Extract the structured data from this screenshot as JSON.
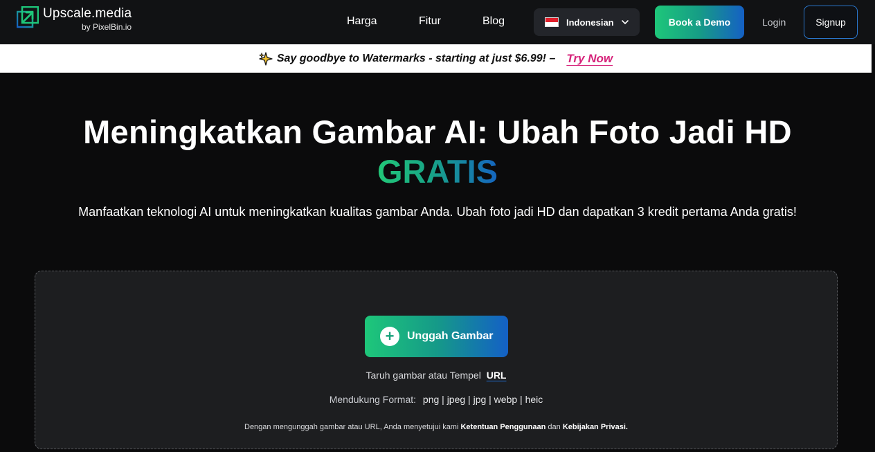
{
  "nav": {
    "brand": "Upscale.media",
    "brand_sub": "by PixelBin.io",
    "links": [
      "Harga",
      "Fitur",
      "Blog"
    ],
    "language": "Indonesian",
    "demo_label": "Book a Demo",
    "login_label": "Login",
    "signup_label": "Signup"
  },
  "banner": {
    "text": "Say goodbye to Watermarks - starting at just $6.99! –",
    "link": "Try Now"
  },
  "hero": {
    "title": "Meningkatkan Gambar AI: Ubah Foto Jadi HD",
    "accent": "GRATIS",
    "subtitle": "Manfaatkan teknologi AI untuk meningkatkan kualitas gambar Anda. Ubah foto jadi HD dan dapatkan 3 kredit pertama Anda gratis!"
  },
  "upload": {
    "button_label": "Unggah Gambar",
    "drop_text": "Taruh gambar atau Tempel",
    "url_label": "URL",
    "formats_label": "Mendukung Format:",
    "formats": "png | jpeg | jpg | webp | heic",
    "terms_prefix": "Dengan mengunggah gambar atau URL, Anda menyetujui kami",
    "terms_link": "Ketentuan Penggunaan",
    "terms_and": "dan",
    "privacy_link": "Kebijakan Privasi."
  },
  "colors": {
    "accent_green": "#1ec77a",
    "accent_blue": "#1560c4",
    "banner_link": "#d6237a"
  }
}
